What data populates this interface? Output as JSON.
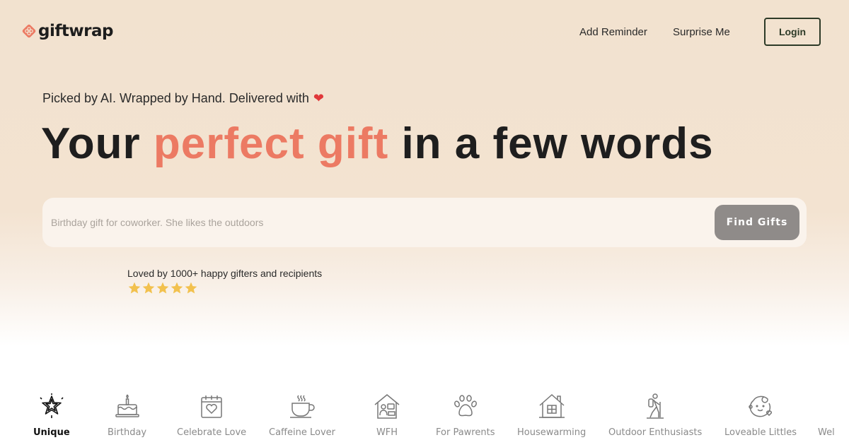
{
  "brand": {
    "name": "giftwrap",
    "accent_color": "#ec7a63"
  },
  "nav": {
    "links": [
      "Add Reminder",
      "Surprise Me"
    ],
    "login_label": "Login"
  },
  "hero": {
    "tagline": "Picked by AI. Wrapped by Hand. Delivered with",
    "tagline_icon": "heart-emoji",
    "headline_before": "Your ",
    "headline_accent": "perfect gift",
    "headline_after": " in a few words"
  },
  "search": {
    "placeholder": "Birthday gift for coworker. She likes the outdoors",
    "value": "",
    "button_label": "Find Gifts"
  },
  "social_proof": {
    "text": "Loved by 1000+ happy gifters and recipients",
    "rating": 5,
    "rating_max": 5,
    "star_color": "#f2c14e"
  },
  "categories": [
    {
      "label": "Unique",
      "icon": "sparkle-star-icon",
      "active": true
    },
    {
      "label": "Birthday",
      "icon": "birthday-cake-icon",
      "active": false
    },
    {
      "label": "Celebrate Love",
      "icon": "calendar-heart-icon",
      "active": false
    },
    {
      "label": "Caffeine Lover",
      "icon": "coffee-cup-icon",
      "active": false
    },
    {
      "label": "WFH",
      "icon": "home-office-icon",
      "active": false
    },
    {
      "label": "For Pawrents",
      "icon": "paw-icon",
      "active": false
    },
    {
      "label": "Housewarming",
      "icon": "house-icon",
      "active": false
    },
    {
      "label": "Outdoor Enthusiasts",
      "icon": "hiker-icon",
      "active": false
    },
    {
      "label": "Loveable Littles",
      "icon": "baby-face-icon",
      "active": false
    },
    {
      "label": "Wel",
      "icon": "",
      "active": false
    }
  ]
}
